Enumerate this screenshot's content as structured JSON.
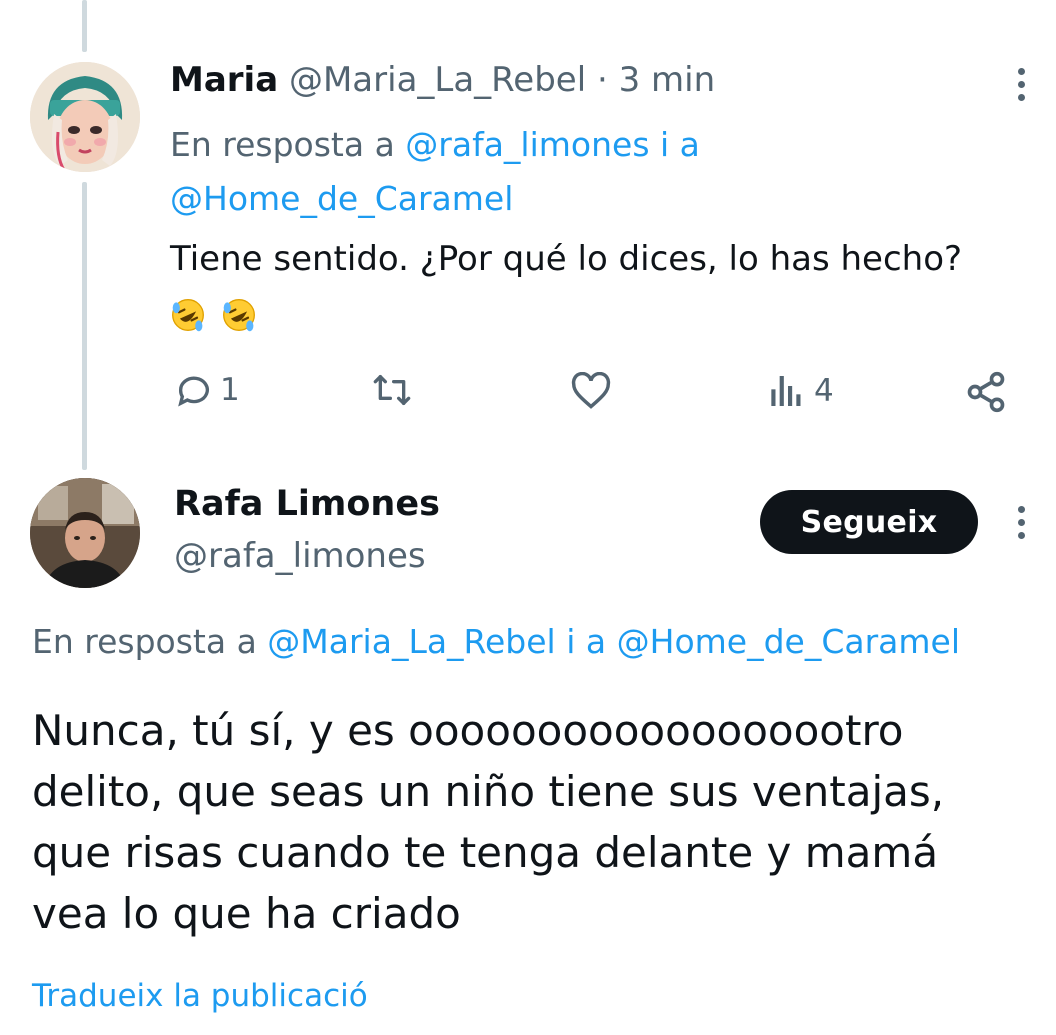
{
  "colors": {
    "link": "#1d9bf0",
    "muted": "#536471",
    "text": "#0f1419",
    "button_bg": "#0f1419"
  },
  "tweet1": {
    "author_name": "Maria",
    "handle": "@Maria_La_Rebel",
    "separator": "·",
    "time": "3 min",
    "reply_prefix": "En resposta a",
    "reply_user1": "@rafa_limones",
    "reply_conj": "i a",
    "reply_user2": "@Home_de_Caramel",
    "text": "Tiene sentido. ¿Por qué lo dices, lo has hecho?",
    "emoji": [
      "rolling-on-floor-laughing",
      "rolling-on-floor-laughing"
    ],
    "actions": {
      "reply_count": "1",
      "retweet_count": "",
      "like_count": "",
      "views_count": "4"
    }
  },
  "tweet2": {
    "author_name": "Rafa Limones",
    "handle": "@rafa_limones",
    "follow_label": "Segueix",
    "reply_prefix": "En resposta a",
    "reply_user1": "@Maria_La_Rebel",
    "reply_conj": "i a",
    "reply_user2": "@Home_de_Caramel",
    "text_lines": [
      "Nunca, tú sí, y es oooooooooooooooootro",
      "delito, que seas un niño tiene sus ventajas,",
      "que risas cuando te tenga delante y mamá",
      "vea lo que ha criado"
    ],
    "translate_label": "Tradueix la publicació"
  }
}
